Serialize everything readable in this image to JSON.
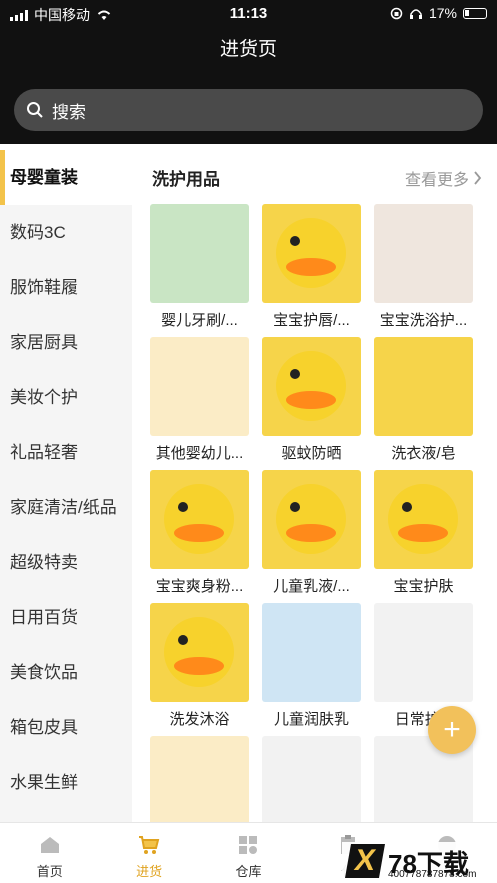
{
  "status_bar": {
    "carrier": "中国移动",
    "time": "11:13",
    "battery": "17%"
  },
  "header": {
    "title": "进货页"
  },
  "search": {
    "placeholder": "搜索"
  },
  "sidebar": {
    "items": [
      {
        "label": "母婴童装",
        "active": true
      },
      {
        "label": "数码3C"
      },
      {
        "label": "服饰鞋履"
      },
      {
        "label": "家居厨具"
      },
      {
        "label": "美妆个护"
      },
      {
        "label": "礼品轻奢"
      },
      {
        "label": "家庭清洁/纸品"
      },
      {
        "label": "超级特卖"
      },
      {
        "label": "日用百货"
      },
      {
        "label": "美食饮品"
      },
      {
        "label": "箱包皮具"
      },
      {
        "label": "水果生鲜"
      }
    ]
  },
  "section": {
    "title": "洗护用品",
    "more": "查看更多"
  },
  "products": [
    {
      "label": "婴儿牙刷/...",
      "thumb": "green"
    },
    {
      "label": "宝宝护唇/...",
      "thumb": "yellow"
    },
    {
      "label": "宝宝洗浴护...",
      "thumb": "beige"
    },
    {
      "label": "其他婴幼儿...",
      "thumb": "light"
    },
    {
      "label": "驱蚊防晒",
      "thumb": "yellow"
    },
    {
      "label": "洗衣液/皂",
      "thumb": "yellow"
    },
    {
      "label": "宝宝爽身粉...",
      "thumb": "yellow"
    },
    {
      "label": "儿童乳液/...",
      "thumb": "yellow"
    },
    {
      "label": "宝宝护肤",
      "thumb": "yellow"
    },
    {
      "label": "洗发沐浴",
      "thumb": "yellow"
    },
    {
      "label": "儿童润肤乳",
      "thumb": "blue"
    },
    {
      "label": "日常护...",
      "thumb": "white"
    },
    {
      "label": "",
      "thumb": "light"
    },
    {
      "label": "",
      "thumb": "white"
    },
    {
      "label": "",
      "thumb": "white"
    }
  ],
  "fab": {
    "symbol": "+"
  },
  "tabbar": {
    "tabs": [
      {
        "label": "首页",
        "icon": "home-icon"
      },
      {
        "label": "进货",
        "icon": "cart-icon",
        "active": true
      },
      {
        "label": "仓库",
        "icon": "grid-icon"
      },
      {
        "label": "任",
        "icon": "task-icon"
      },
      {
        "label": "",
        "icon": "profile-icon"
      }
    ]
  },
  "watermark": {
    "x": "X",
    "brand": "78下载",
    "url": "400778787878.com"
  },
  "colors": {
    "accent": "#f3c34a",
    "header_bg": "#111111",
    "tab_active": "#e0a320"
  }
}
